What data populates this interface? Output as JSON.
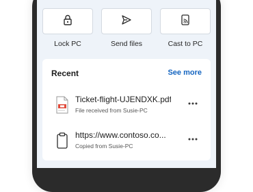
{
  "actions": [
    {
      "label": "Lock PC",
      "icon": "lock-icon"
    },
    {
      "label": "Send files",
      "icon": "send-icon"
    },
    {
      "label": "Cast to PC",
      "icon": "cast-icon"
    }
  ],
  "recent": {
    "title": "Recent",
    "see_more": "See more",
    "items": [
      {
        "name": "Ticket-flight-UJENDXK.pdf",
        "subtitle": "File received from Susie-PC",
        "icon": "pdf-file-icon"
      },
      {
        "name": "https://www.contoso.co...",
        "subtitle": "Copied from Susie-PC",
        "icon": "clipboard-icon"
      }
    ]
  },
  "colors": {
    "accent": "#1565c0",
    "screen_bg": "#eef3f9",
    "pdf_red": "#e04a3a"
  }
}
